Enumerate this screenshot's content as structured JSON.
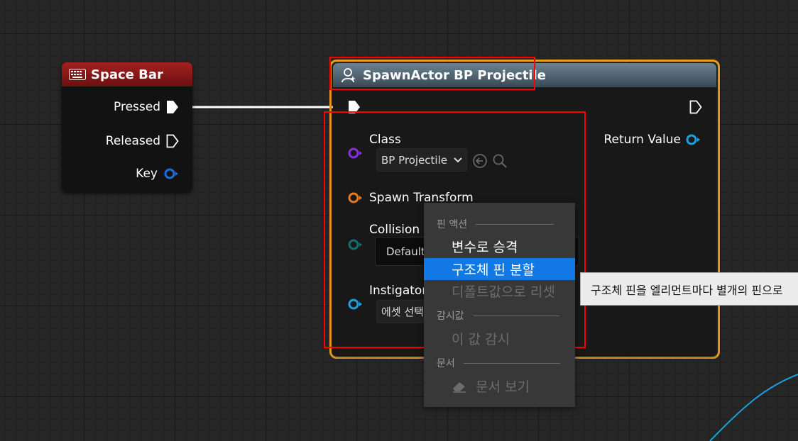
{
  "space_bar_node": {
    "title": "Space Bar",
    "pins": {
      "pressed": "Pressed",
      "released": "Released",
      "key": "Key"
    }
  },
  "spawn_node": {
    "title": "SpawnActor BP Projectile",
    "return_value": "Return Value",
    "class_label": "Class",
    "class_value": "BP Projectile",
    "spawn_transform_label": "Spawn Transform",
    "collision_label": "Collision H",
    "collision_value": "Default",
    "instigator_label": "Instigator",
    "instigator_value": "에셋 선택"
  },
  "context_menu": {
    "section_pin_actions": "핀 액션",
    "promote_to_variable": "변수로 승격",
    "split_struct_pin": "구조체 핀 분할",
    "reset_to_default": "디폴트값으로 리셋",
    "section_watch": "감시값",
    "watch_this_value": "이 값 감시",
    "section_docs": "문서",
    "view_documentation": "문서 보기"
  },
  "tooltip": {
    "text": "구조체 핀을 엘리먼트마다 별개의 핀으로"
  },
  "colors": {
    "canvas_bg": "#262626",
    "node_body": "#121212",
    "space_bar_header": "#8b1a1a",
    "spawn_header": "#4d6370",
    "selection_outline": "#f0a020",
    "highlight_box": "#ff0000",
    "menu_bg": "#383838",
    "menu_highlight": "#1178e6",
    "class_pin": "#8a2be2",
    "transform_pin": "#e87a1a",
    "object_pin": "#1aa0e0",
    "enum_pin": "#0f6e6e"
  },
  "icons": [
    "keyboard-icon",
    "spawn-actor-icon",
    "exec-pin-icon",
    "data-pin-icon",
    "chevron-down-icon",
    "arrow-left-circle-icon",
    "search-icon",
    "eraser-icon"
  ]
}
